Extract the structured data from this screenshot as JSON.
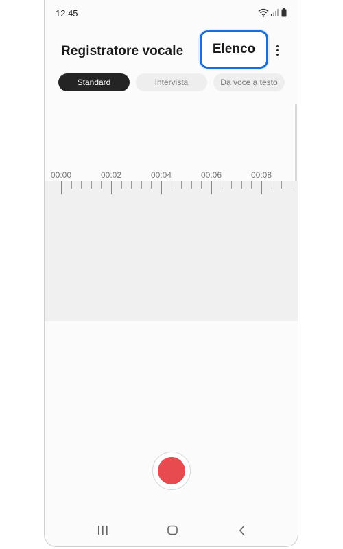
{
  "status_bar": {
    "time": "12:45",
    "icons": [
      "wifi-icon",
      "signal-icon",
      "battery-icon"
    ]
  },
  "header": {
    "title": "Registratore vocale",
    "list_button_label": "Elenco",
    "more_options_icon": "more-vertical-icon",
    "highlight_color": "#1a6fd6"
  },
  "tabs": [
    {
      "label": "Standard",
      "active": true
    },
    {
      "label": "Intervista",
      "active": false
    },
    {
      "label": "Da voce a testo",
      "active": false
    }
  ],
  "timeline": {
    "labels": [
      "00:00",
      "00:02",
      "00:04",
      "00:06",
      "00:08"
    ]
  },
  "controls": {
    "record_icon": "record-icon",
    "record_color": "#e84b4f"
  },
  "navigation": {
    "recents_icon": "recents-icon",
    "home_icon": "home-icon",
    "back_icon": "back-icon"
  }
}
